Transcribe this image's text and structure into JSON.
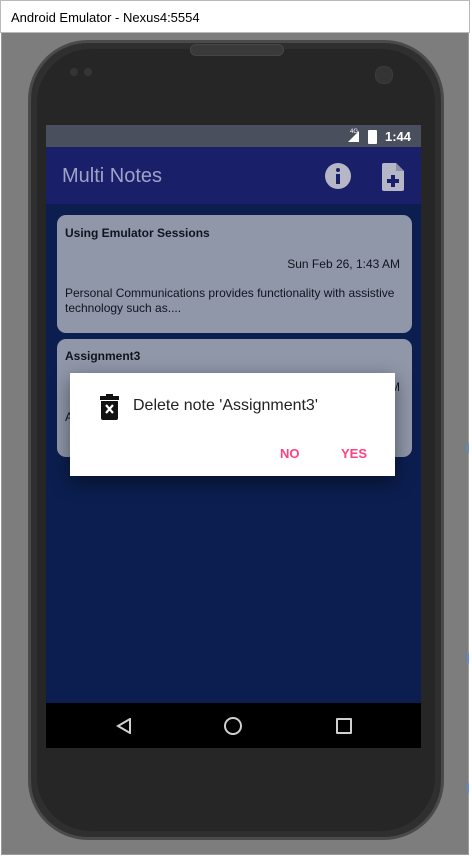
{
  "window": {
    "title": "Android Emulator - Nexus4:5554"
  },
  "status_bar": {
    "network": "4G",
    "time": "1:44"
  },
  "app_bar": {
    "title": "Multi Notes",
    "icons": [
      "info-icon",
      "add-note-icon"
    ]
  },
  "notes": [
    {
      "title": "Using Emulator Sessions",
      "date": "Sun Feb 26, 1:43 AM",
      "text": "Personal Communications provides functionality with assistive technology such as...."
    },
    {
      "title": "Assignment3",
      "date": "M",
      "text": "A"
    }
  ],
  "dialog": {
    "icon": "delete-icon",
    "title": "Delete note 'Assignment3'",
    "no_label": "NO",
    "yes_label": "YES"
  },
  "nav_bar": {
    "icons": [
      "back-icon",
      "home-icon",
      "recents-icon"
    ]
  },
  "colors": {
    "accent": "#ff4081",
    "app_bar": "#1a1f6a",
    "background": "#0b1e4f",
    "card": "#8f97a9"
  }
}
